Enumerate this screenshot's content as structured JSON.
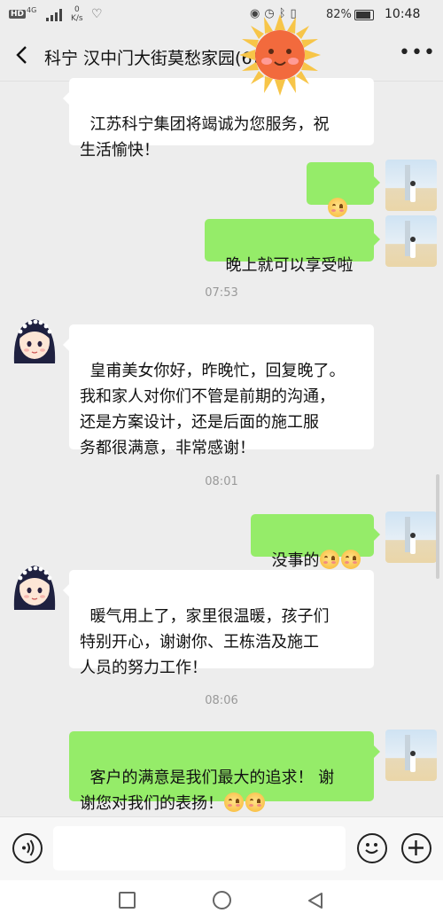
{
  "status_bar": {
    "hd": "HD",
    "network": "4G",
    "speed_value": "0",
    "speed_unit": "K/s",
    "battery": "82%",
    "time": "10:48"
  },
  "header": {
    "title": "科宁 汉中门大街莫愁家园",
    "count": "(6)"
  },
  "messages": [
    {
      "side": "in",
      "text": "江苏科宁集团将竭诚为您服务，祝\n生活愉快！"
    },
    {
      "side": "out",
      "text": "",
      "emoji_count": 2
    },
    {
      "side": "out",
      "text": "晚上就可以享受啦"
    },
    {
      "side": "time",
      "text": "07:53"
    },
    {
      "side": "in",
      "text": "皇甫美女你好，昨晚忙，回复晚了。\n我和家人对你们不管是前期的沟通，\n还是方案设计，还是后面的施工服\n务都很满意，非常感谢！"
    },
    {
      "side": "time",
      "text": "08:01"
    },
    {
      "side": "out",
      "text": "没事的",
      "emoji_count": 2
    },
    {
      "side": "in",
      "text": "暖气用上了，家里很温暖，孩子们\n特别开心，谢谢你、王栋浩及施工\n人员的努力工作！"
    },
    {
      "side": "time",
      "text": "08:06"
    },
    {
      "side": "out",
      "text": "客户的满意是我们最大的追求！ 谢\n谢您对我们的表扬！",
      "emoji_count": 2
    }
  ],
  "colors": {
    "background": "#ededed",
    "bubble_out": "#95ec69",
    "bubble_in": "#ffffff",
    "timestamp": "#999999"
  },
  "icons": {
    "back": "chevron-left-icon",
    "more": "more-dots-icon",
    "voice": "voice-icon",
    "emoji": "emoji-icon",
    "plus": "plus-icon"
  }
}
